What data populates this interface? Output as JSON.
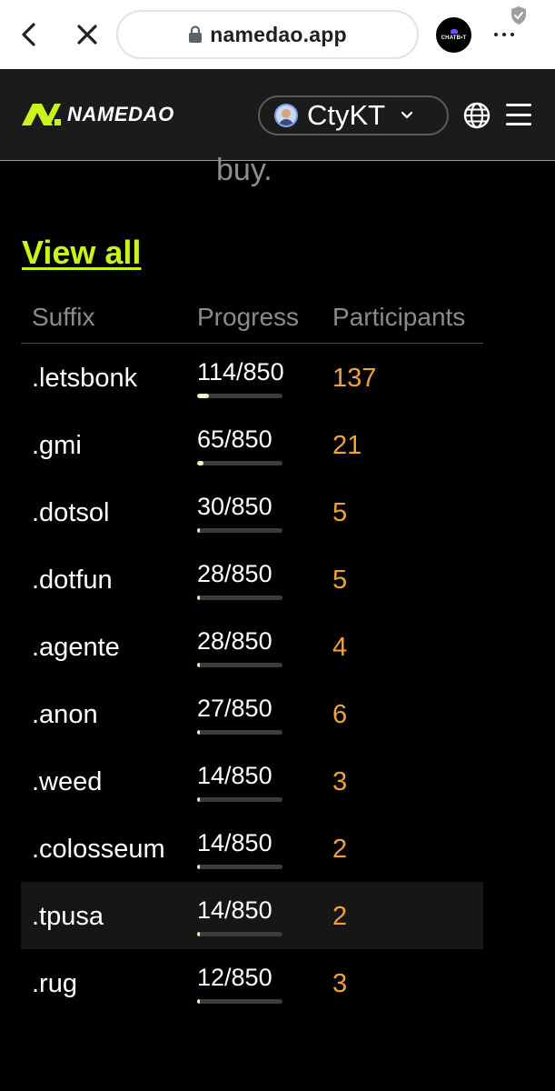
{
  "browser": {
    "url": "namedao.app",
    "extension_label": "CHATB•T"
  },
  "header": {
    "logo_text": "NAMEDAO",
    "account_name": "CtyKT"
  },
  "content": {
    "partial_text": "buy.",
    "view_all_label": "View all"
  },
  "table": {
    "columns": [
      "Suffix",
      "Progress",
      "Participants"
    ],
    "rows": [
      {
        "suffix": ".letsbonk",
        "progress": "114/850",
        "fraction": 0.134,
        "participants": "137"
      },
      {
        "suffix": ".gmi",
        "progress": "65/850",
        "fraction": 0.076,
        "participants": "21"
      },
      {
        "suffix": ".dotsol",
        "progress": "30/850",
        "fraction": 0.035,
        "participants": "5"
      },
      {
        "suffix": ".dotfun",
        "progress": "28/850",
        "fraction": 0.033,
        "participants": "5"
      },
      {
        "suffix": ".agente",
        "progress": "28/850",
        "fraction": 0.033,
        "participants": "4"
      },
      {
        "suffix": ".anon",
        "progress": "27/850",
        "fraction": 0.032,
        "participants": "6"
      },
      {
        "suffix": ".weed",
        "progress": "14/850",
        "fraction": 0.016,
        "participants": "3"
      },
      {
        "suffix": ".colosseum",
        "progress": "14/850",
        "fraction": 0.016,
        "participants": "2"
      },
      {
        "suffix": ".tpusa",
        "progress": "14/850",
        "fraction": 0.016,
        "participants": "2",
        "highlighted": true
      },
      {
        "suffix": ".rug",
        "progress": "12/850",
        "fraction": 0.014,
        "participants": "3"
      }
    ]
  },
  "colors": {
    "accent": "#c9f31d",
    "participants": "#f0a33a",
    "progress_fill": "#f3f5b0",
    "header_bg": "#1b1b1b"
  }
}
